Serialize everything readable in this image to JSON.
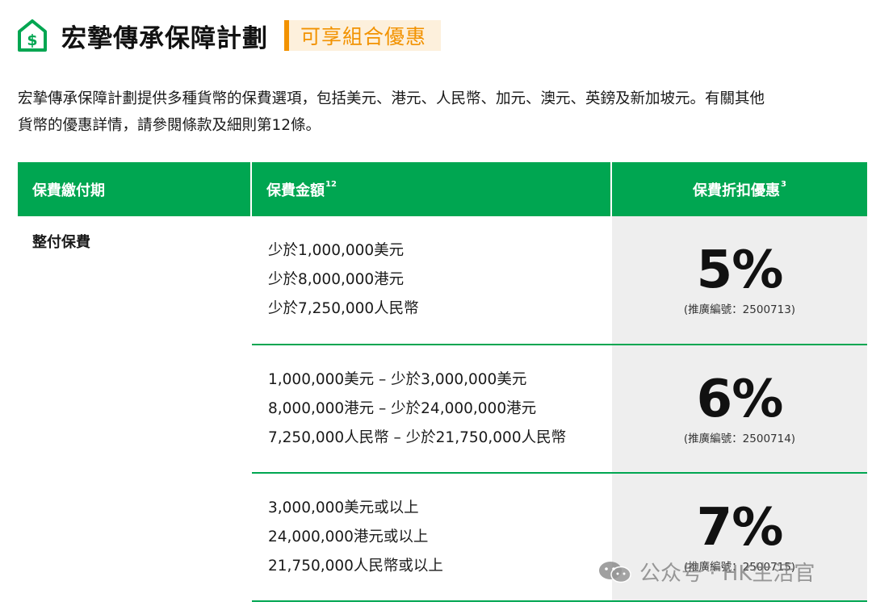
{
  "header": {
    "title": "宏摯傳承保障計劃",
    "promo": "可享組合優惠",
    "logo_icon": "house-dollar-icon",
    "logo_color": "#00a651"
  },
  "intro": {
    "line1": "宏摯傳承保障計劃提供多種貨幣的保費選項，包括美元、港元、人民幣、加元、澳元、英鎊及新加坡元。有關其他",
    "line2": "貨幣的優惠詳情，請參閱條款及細則第12條。"
  },
  "table": {
    "headers": {
      "payment_term": "保費繳付期",
      "amount": "保費金額",
      "amount_sup": "12",
      "discount": "保費折扣優惠",
      "discount_sup": "3"
    },
    "payment_term": "整付保費",
    "rows": [
      {
        "amounts": [
          "少於1,000,000美元",
          "少於8,000,000港元",
          "少於7,250,000人民幣"
        ],
        "discount": "5%",
        "code": "(推廣編號：2500713)"
      },
      {
        "amounts": [
          "1,000,000美元 – 少於3,000,000美元",
          "8,000,000港元 – 少於24,000,000港元",
          "7,250,000人民幣 – 少於21,750,000人民幣"
        ],
        "discount": "6%",
        "code": "(推廣編號：2500714)"
      },
      {
        "amounts": [
          "3,000,000美元或以上",
          "24,000,000港元或以上",
          "21,750,000人民幣或以上"
        ],
        "discount": "7%",
        "code": "(推廣編號：2500715)"
      }
    ]
  },
  "watermark": {
    "text": "公众号 · HK生活官",
    "icon": "wechat-icon"
  },
  "colors": {
    "brand_green": "#00a651",
    "accent_orange": "#f29200",
    "promo_bg": "#fdf0dc",
    "discount_bg": "#eeeeee"
  }
}
